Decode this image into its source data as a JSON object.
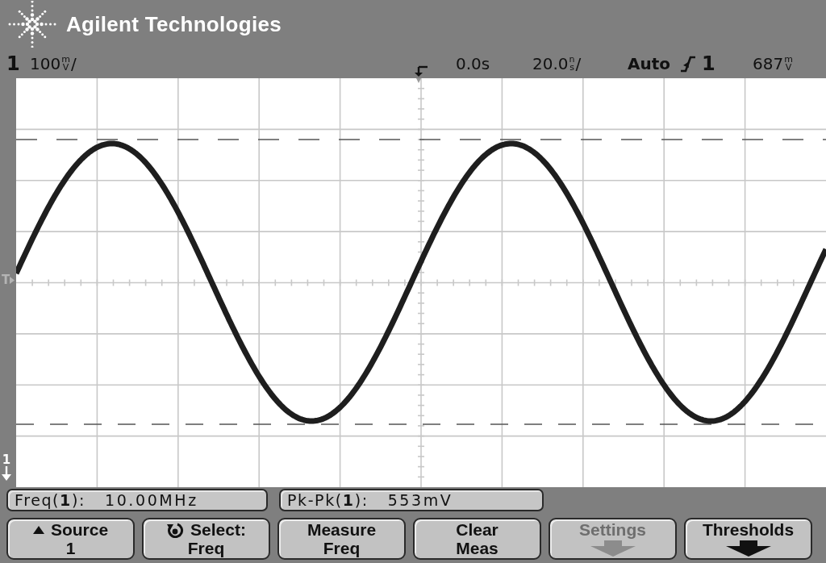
{
  "header": {
    "brand": "Agilent Technologies"
  },
  "status_line": {
    "channel": "1",
    "volts_per_div": {
      "number": "100",
      "unit_top": "m",
      "unit_bottom": "V",
      "suffix": "/"
    },
    "delay": "0.0s",
    "time_per_div": {
      "number": "20.0",
      "unit_top": "n",
      "unit_bottom": "s",
      "suffix": "/"
    },
    "trigger_mode": "Auto",
    "trigger_source": "1",
    "trigger_level": {
      "number": "687",
      "unit_top": "m",
      "unit_bottom": "V"
    }
  },
  "display": {
    "trigger_level_marker": "T",
    "ground_marker": "1"
  },
  "measurements": [
    {
      "label": "Freq(**1**):",
      "value": "10.00MHz"
    },
    {
      "label": "Pk-Pk(**1**):",
      "value": "553mV"
    }
  ],
  "softkeys": [
    {
      "kind": "source",
      "line_1": "Source",
      "line_2": "1",
      "disabled": false
    },
    {
      "kind": "select",
      "line_1": "Select:",
      "line_2": "Freq",
      "disabled": false
    },
    {
      "kind": "plain",
      "line_1": "Measure",
      "line_2": "Freq",
      "disabled": false
    },
    {
      "kind": "plain",
      "line_1": "Clear",
      "line_2": "Meas",
      "disabled": false
    },
    {
      "kind": "menu",
      "line_1": "Settings",
      "disabled": true
    },
    {
      "kind": "menu",
      "line_1": "Thresholds",
      "disabled": false
    }
  ]
}
